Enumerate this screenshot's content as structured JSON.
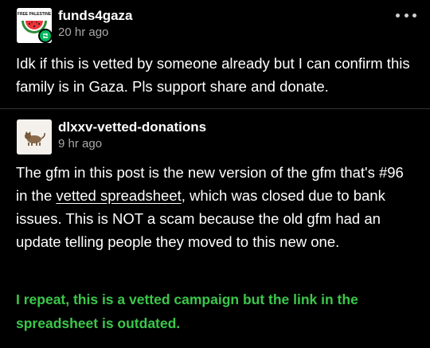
{
  "posts": [
    {
      "username": "funds4gaza",
      "timestamp": "20 hr ago",
      "avatar_text": "FREE PALESTINE",
      "icon": "watermelon-icon",
      "badge_icon": "reblog-icon",
      "body": "Idk if this is vetted by someone already but I can confirm this family is in Gaza. Pls support share and donate."
    },
    {
      "username": "dlxxv-vetted-donations",
      "timestamp": "9 hr ago",
      "icon": "cat-avatar-icon",
      "body_before_link": "The gfm in this post is the new version of the gfm that's #96 in the ",
      "link_text": "vetted spreadsheet",
      "body_after_link": ", which was closed due to bank issues. This is NOT a scam because the old gfm had an update telling people they moved to this new one.",
      "highlight": "I repeat, this is a vetted campaign but the link in the spreadsheet is outdated."
    }
  ],
  "more_icon": "more-options-icon",
  "colors": {
    "background": "#000000",
    "text": "#ffffff",
    "muted": "#a9a9a9",
    "highlight_green": "#3bc74a",
    "badge_green": "#00b85c"
  }
}
